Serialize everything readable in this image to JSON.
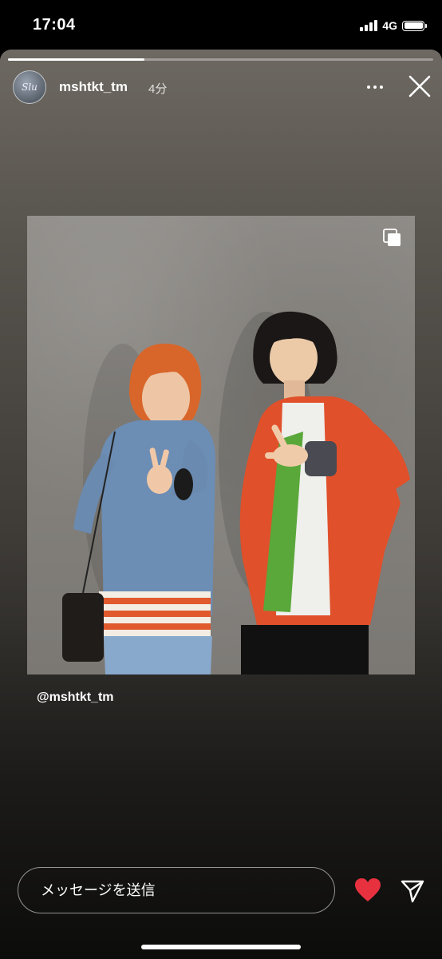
{
  "status_bar": {
    "time": "17:04",
    "network": "4G"
  },
  "story": {
    "progress": 0.32,
    "username": "mshtkt_tm",
    "time_ago": "4分",
    "avatar_text": "Slu",
    "mention": "@mshtkt_tm"
  },
  "icons": {
    "more": "more-horizontal-icon",
    "close": "close-icon",
    "multi": "multiple-images-icon",
    "heart": "heart-icon",
    "send": "send-icon"
  },
  "composer": {
    "placeholder": "メッセージを送信"
  },
  "colors": {
    "heart": "#e8313f",
    "accent": "#ffffff"
  }
}
